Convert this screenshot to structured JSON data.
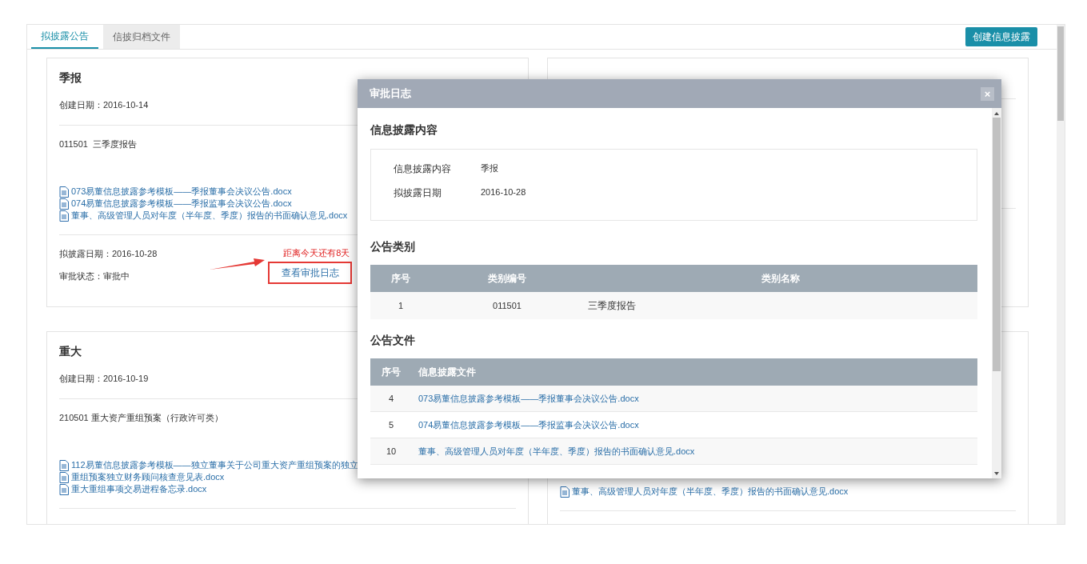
{
  "tabs": [
    {
      "label": "拟披露公告",
      "selected": true
    },
    {
      "label": "信披归档文件",
      "selected": false
    }
  ],
  "create_button": "创建信息披露",
  "left_cards": [
    {
      "title": "季报",
      "created": "创建日期：2016-10-14",
      "category": "011501  三季度报告",
      "files": [
        "073易董信息披露参考模板——季报董事会决议公告.docx",
        "074易董信息披露参考模板——季报监事会决议公告.docx",
        "董事、高级管理人员对年度（半年度、季度）报告的书面确认意见.docx"
      ],
      "planned_date": "拟披露日期：2016-10-28",
      "countdown": "距离今天还有8天",
      "status": "审批状态：审批中",
      "log_button": "查看审批日志"
    },
    {
      "title": "重大",
      "created": "创建日期：2016-10-19",
      "category": "210501 重大资产重组预案（行政许可类）",
      "files": [
        "112易董信息披露参考模板——独立董事关于公司重大资产重组预案的独立",
        "重组预案独立财务顾问核查意见表.docx",
        "重大重组事项交易进程备忘录.docx"
      ]
    }
  ],
  "right_cards": [
    {
      "kind": "upper"
    },
    {
      "kind": "lower",
      "files": [
        "董事、高级管理人员对年度（半年度、季度）报告的书面确认意见.docx"
      ]
    }
  ],
  "modal": {
    "title": "审批日志",
    "close": "×",
    "content_heading": "信息披露内容",
    "fields": [
      {
        "label": "信息披露内容",
        "value": "季报"
      },
      {
        "label": "拟披露日期",
        "value": "2016-10-28"
      }
    ],
    "category_heading": "公告类别",
    "category_table": {
      "columns": [
        "序号",
        "类别编号",
        "类别名称"
      ],
      "rows": [
        [
          "1",
          "011501",
          "三季度报告"
        ]
      ]
    },
    "files_heading": "公告文件",
    "files_table": {
      "columns": [
        "序号",
        "信息披露文件"
      ],
      "rows": [
        [
          "4",
          "073易董信息披露参考模板——季报董事会决议公告.docx"
        ],
        [
          "5",
          "074易董信息披露参考模板——季报监事会决议公告.docx"
        ],
        [
          "10",
          "董事、高级管理人员对年度（半年度、季度）报告的书面确认意见.docx"
        ]
      ]
    }
  }
}
